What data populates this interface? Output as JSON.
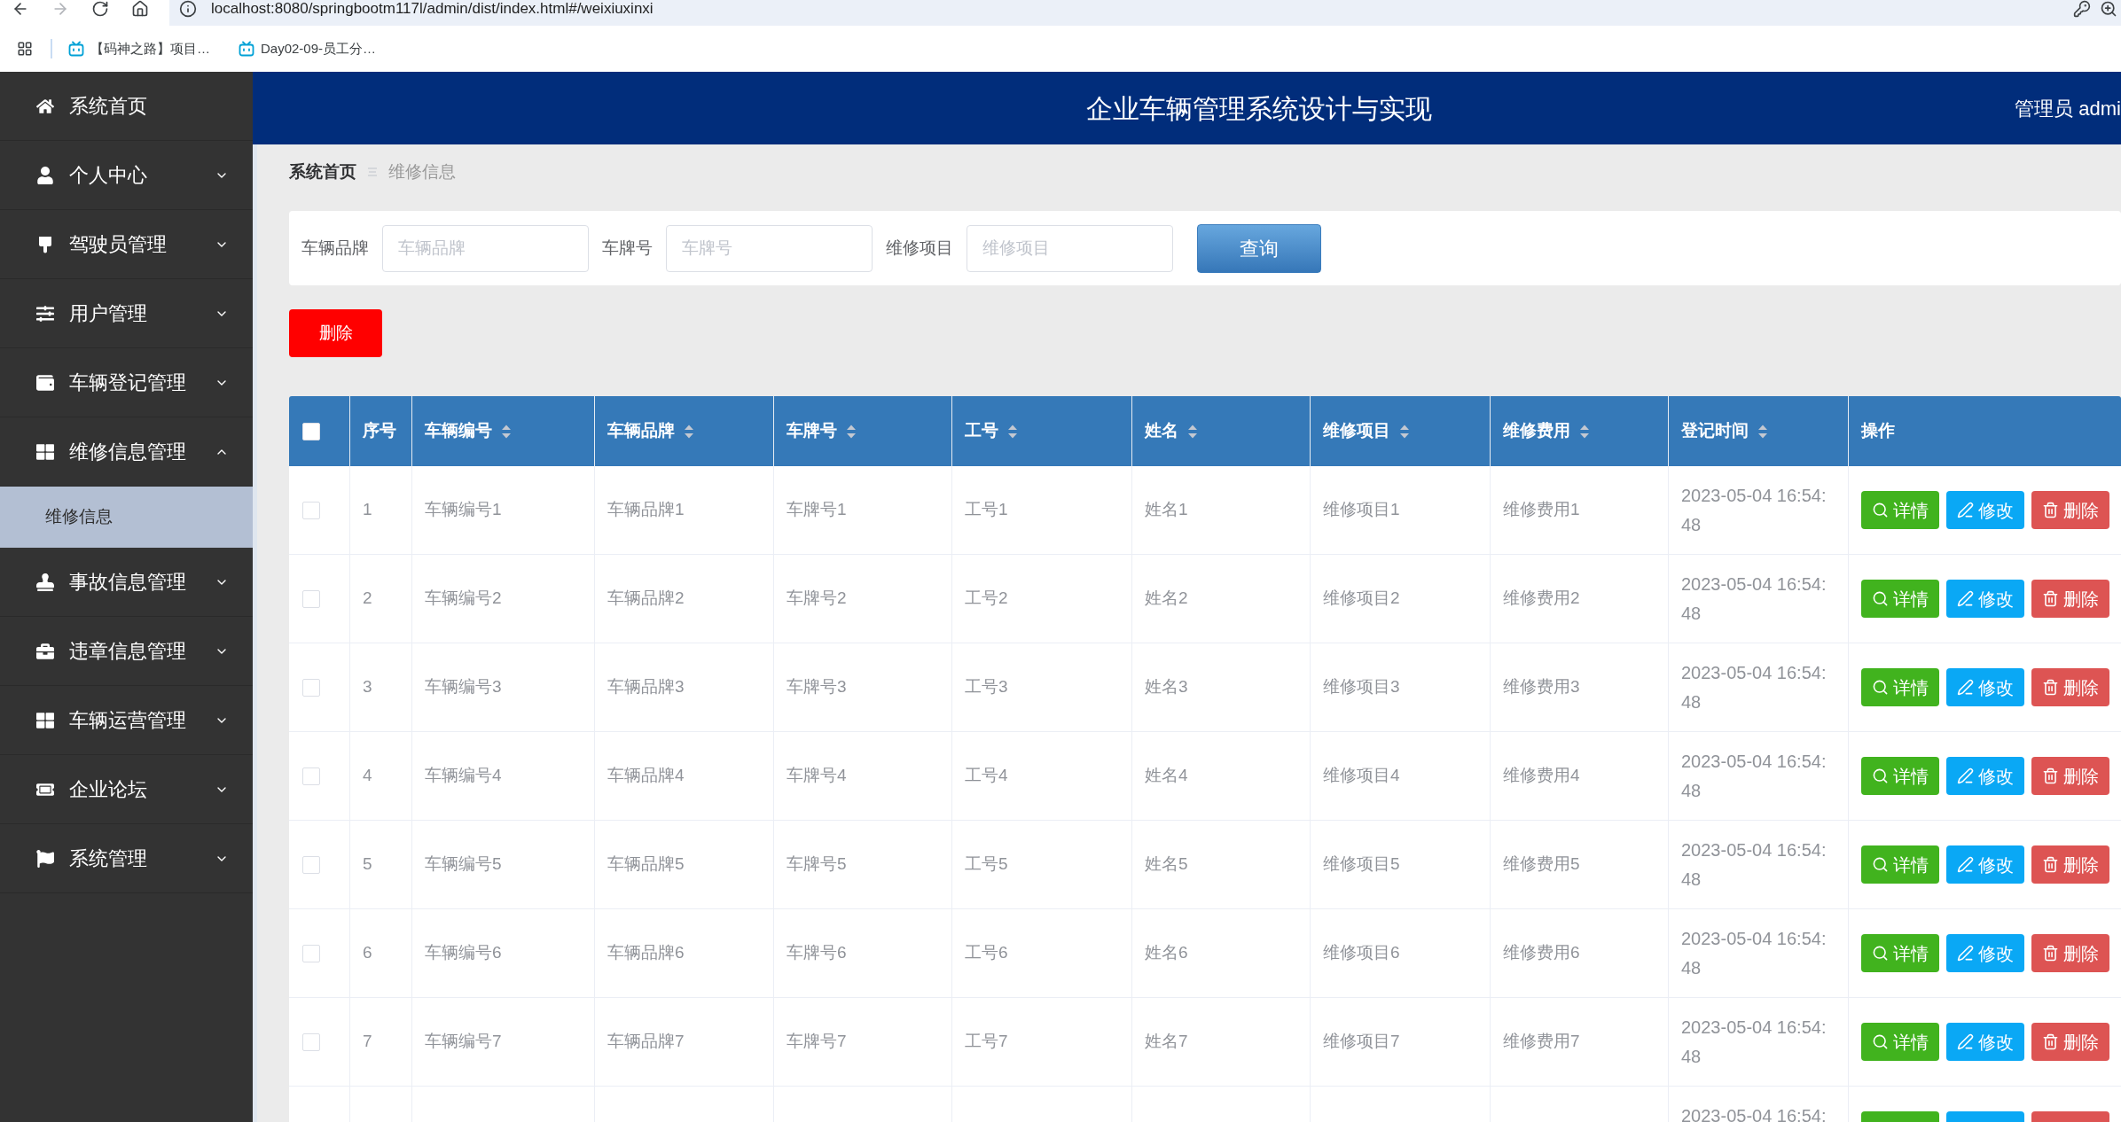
{
  "browser": {
    "nav_buttons": [
      {
        "kind": "back",
        "disabled": false
      },
      {
        "kind": "forward",
        "disabled": true
      },
      {
        "kind": "reload",
        "disabled": false
      },
      {
        "kind": "home",
        "disabled": false
      }
    ],
    "url": "localhost:8080/springbootm117l/admin/dist/index.html#/weixiuxinxi",
    "bookmarks": [
      {
        "label": "【码神之路】项目…"
      },
      {
        "label": "Day02-09-员工分…"
      }
    ]
  },
  "sidebar": {
    "items": [
      {
        "label": "系统首页"
      },
      {
        "label": "个人中心",
        "expanded": false
      },
      {
        "label": "驾驶员管理",
        "expanded": false
      },
      {
        "label": "用户管理",
        "expanded": false
      },
      {
        "label": "车辆登记管理",
        "expanded": false
      },
      {
        "label": "维修信息管理",
        "expanded": true,
        "children": [
          {
            "label": "维修信息",
            "selected": true
          }
        ]
      },
      {
        "label": "事故信息管理",
        "expanded": false
      },
      {
        "label": "违章信息管理",
        "expanded": false
      },
      {
        "label": "车辆运营管理",
        "expanded": false
      },
      {
        "label": "企业论坛",
        "expanded": false
      },
      {
        "label": "系统管理",
        "expanded": false
      }
    ]
  },
  "header": {
    "title": "企业车辆管理系统设计与实现",
    "user": "管理员 admi"
  },
  "breadcrumb": [
    {
      "label": "系统首页"
    },
    {
      "label": "维修信息"
    }
  ],
  "search": {
    "fields": [
      {
        "label": "车辆品牌",
        "placeholder": "车辆品牌"
      },
      {
        "label": "车牌号",
        "placeholder": "车牌号"
      },
      {
        "label": "维修项目",
        "placeholder": "维修项目"
      }
    ],
    "button": "查询"
  },
  "toolbar": {
    "buttons": [
      {
        "label": "删除"
      }
    ]
  },
  "table": {
    "select_all": {
      "checked": false
    },
    "columns": [
      {
        "label": "序号",
        "sortable": false
      },
      {
        "label": "车辆编号",
        "sortable": true
      },
      {
        "label": "车辆品牌",
        "sortable": true
      },
      {
        "label": "车牌号",
        "sortable": true
      },
      {
        "label": "工号",
        "sortable": true
      },
      {
        "label": "姓名",
        "sortable": true
      },
      {
        "label": "维修项目",
        "sortable": true
      },
      {
        "label": "维修费用",
        "sortable": true
      },
      {
        "label": "登记时间",
        "sortable": true
      },
      {
        "label": "操作",
        "sortable": false
      }
    ],
    "rows": [
      {
        "checked": false,
        "no": "1",
        "vehicle_no": "车辆编号1",
        "brand": "车辆品牌1",
        "plate": "车牌号1",
        "staff_no": "工号1",
        "name": "姓名1",
        "repair_item": "维修项目1",
        "repair_cost": "维修费用1",
        "reg_time": "2023-05-04 16:54:48",
        "actions": [
          {
            "kind": "detail",
            "label": "详情"
          },
          {
            "kind": "edit",
            "label": "修改"
          },
          {
            "kind": "delete",
            "label": "删除"
          }
        ]
      },
      {
        "checked": false,
        "no": "2",
        "vehicle_no": "车辆编号2",
        "brand": "车辆品牌2",
        "plate": "车牌号2",
        "staff_no": "工号2",
        "name": "姓名2",
        "repair_item": "维修项目2",
        "repair_cost": "维修费用2",
        "reg_time": "2023-05-04 16:54:48",
        "actions": [
          {
            "kind": "detail",
            "label": "详情"
          },
          {
            "kind": "edit",
            "label": "修改"
          },
          {
            "kind": "delete",
            "label": "删除"
          }
        ]
      },
      {
        "checked": false,
        "no": "3",
        "vehicle_no": "车辆编号3",
        "brand": "车辆品牌3",
        "plate": "车牌号3",
        "staff_no": "工号3",
        "name": "姓名3",
        "repair_item": "维修项目3",
        "repair_cost": "维修费用3",
        "reg_time": "2023-05-04 16:54:48",
        "actions": [
          {
            "kind": "detail",
            "label": "详情"
          },
          {
            "kind": "edit",
            "label": "修改"
          },
          {
            "kind": "delete",
            "label": "删除"
          }
        ]
      },
      {
        "checked": false,
        "no": "4",
        "vehicle_no": "车辆编号4",
        "brand": "车辆品牌4",
        "plate": "车牌号4",
        "staff_no": "工号4",
        "name": "姓名4",
        "repair_item": "维修项目4",
        "repair_cost": "维修费用4",
        "reg_time": "2023-05-04 16:54:48",
        "actions": [
          {
            "kind": "detail",
            "label": "详情"
          },
          {
            "kind": "edit",
            "label": "修改"
          },
          {
            "kind": "delete",
            "label": "删除"
          }
        ]
      },
      {
        "checked": false,
        "no": "5",
        "vehicle_no": "车辆编号5",
        "brand": "车辆品牌5",
        "plate": "车牌号5",
        "staff_no": "工号5",
        "name": "姓名5",
        "repair_item": "维修项目5",
        "repair_cost": "维修费用5",
        "reg_time": "2023-05-04 16:54:48",
        "actions": [
          {
            "kind": "detail",
            "label": "详情"
          },
          {
            "kind": "edit",
            "label": "修改"
          },
          {
            "kind": "delete",
            "label": "删除"
          }
        ]
      },
      {
        "checked": false,
        "no": "6",
        "vehicle_no": "车辆编号6",
        "brand": "车辆品牌6",
        "plate": "车牌号6",
        "staff_no": "工号6",
        "name": "姓名6",
        "repair_item": "维修项目6",
        "repair_cost": "维修费用6",
        "reg_time": "2023-05-04 16:54:48",
        "actions": [
          {
            "kind": "detail",
            "label": "详情"
          },
          {
            "kind": "edit",
            "label": "修改"
          },
          {
            "kind": "delete",
            "label": "删除"
          }
        ]
      },
      {
        "checked": false,
        "no": "7",
        "vehicle_no": "车辆编号7",
        "brand": "车辆品牌7",
        "plate": "车牌号7",
        "staff_no": "工号7",
        "name": "姓名7",
        "repair_item": "维修项目7",
        "repair_cost": "维修费用7",
        "reg_time": "2023-05-04 16:54:48",
        "actions": [
          {
            "kind": "detail",
            "label": "详情"
          },
          {
            "kind": "edit",
            "label": "修改"
          },
          {
            "kind": "delete",
            "label": "删除"
          }
        ]
      },
      {
        "reg_time": "2023-05-04 16:54:",
        "actions": [
          {
            "kind": "detail"
          },
          {
            "kind": "edit"
          },
          {
            "kind": "delete"
          }
        ]
      }
    ]
  }
}
